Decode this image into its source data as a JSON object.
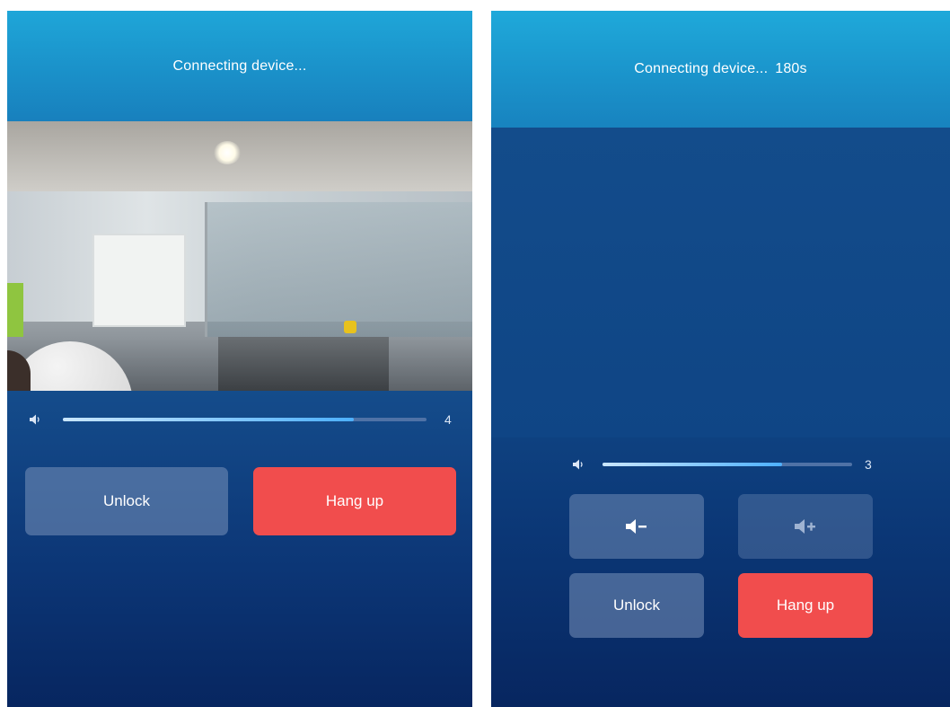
{
  "left": {
    "header_title": "Connecting device...",
    "volume_value": "4",
    "volume_fraction": 0.8,
    "unlock_label": "Unlock",
    "hangup_label": "Hang up"
  },
  "right": {
    "header_title": "Connecting device...",
    "countdown": "180s",
    "volume_value": "3",
    "volume_fraction": 0.72,
    "volume_down_icon": "volume-down-icon",
    "volume_up_icon": "volume-up-icon",
    "unlock_label": "Unlock",
    "hangup_label": "Hang up"
  },
  "colors": {
    "header_cyan": "#1fa6d8",
    "background_navy": "#0c3676",
    "hangup_red": "#f14d4d",
    "slider_fill": "#4db0ff"
  }
}
